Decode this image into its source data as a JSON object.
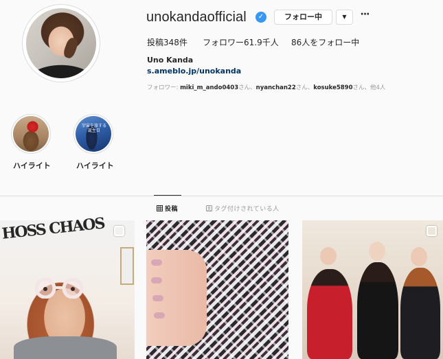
{
  "profile": {
    "username": "unokandaofficial",
    "follow_button": "フォロー中",
    "dropdown_glyph": "▼",
    "more_glyph": "···",
    "stats": {
      "posts": "投稿348件",
      "followers": "フォロワー61.9千人",
      "following": "86人をフォロー中"
    },
    "full_name": "Uno Kanda",
    "bio_link": "s.ameblo.jp/unokanda",
    "followed_by": {
      "prefix": "フォロワー: ",
      "user1": "miki_m_ando0403",
      "sep1": "さん、",
      "user2": "nyanchan22",
      "sep2": "さん、",
      "user3": "kosuke5890",
      "suffix": "さん、他4人"
    }
  },
  "highlights": [
    {
      "label": "ハイライト"
    },
    {
      "label": "ハイライト",
      "overlay_text": "宇宙を旅する誕生日"
    }
  ],
  "tabs": {
    "posts": "投稿",
    "tagged": "タグ付けされている人"
  },
  "posts": [
    {
      "graffiti_text": "HOSS CHAOS"
    },
    {},
    {}
  ],
  "colors": {
    "verified": "#3897f0",
    "link": "#003569",
    "muted": "#999999",
    "border": "#dbdbdb",
    "background": "#fafafa"
  },
  "icons": {
    "verified": "check-badge-icon",
    "grid": "grid-icon",
    "tag": "tag-person-icon",
    "checkbox": "multiple-posts-icon"
  }
}
